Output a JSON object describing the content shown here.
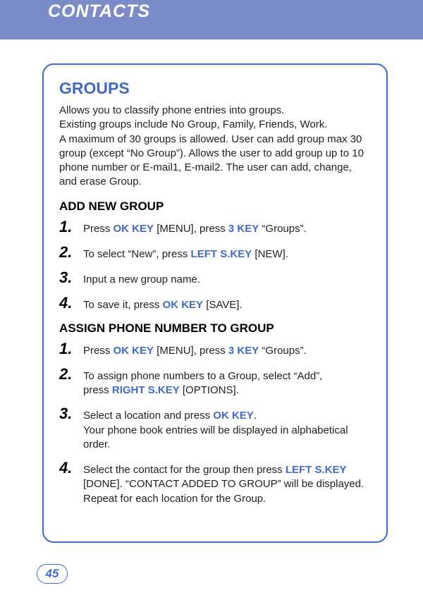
{
  "header": {
    "title": "CONTACTS"
  },
  "section": {
    "title": "GROUPS",
    "intro": "Allows you to classify phone entries into groups.\nExisting groups include No Group, Family, Friends, Work.\nA maximum of 30 groups is allowed. User can add group max 30 group (except “No Group”). Allows the user to add group up to 10 phone number or E-mail1, E-mail2. The user can add, change, and erase Group."
  },
  "sub1": {
    "heading": "ADD NEW GROUP",
    "steps": [
      {
        "num": "1.",
        "parts": [
          {
            "t": "Press ",
            "b": false
          },
          {
            "t": "OK KEY",
            "b": true
          },
          {
            "t": " [MENU], press ",
            "b": false
          },
          {
            "t": "3 KEY",
            "b": true
          },
          {
            "t": " “Groups”.",
            "b": false
          }
        ]
      },
      {
        "num": "2.",
        "parts": [
          {
            "t": "To select “New”, press ",
            "b": false
          },
          {
            "t": "LEFT S.KEY",
            "b": true
          },
          {
            "t": " [NEW].",
            "b": false
          }
        ]
      },
      {
        "num": "3.",
        "parts": [
          {
            "t": "Input a new group name.",
            "b": false
          }
        ]
      },
      {
        "num": "4.",
        "parts": [
          {
            "t": "To save it, press ",
            "b": false
          },
          {
            "t": "OK KEY",
            "b": true
          },
          {
            "t": " [SAVE].",
            "b": false
          }
        ]
      }
    ]
  },
  "sub2": {
    "heading": "ASSIGN PHONE NUMBER TO GROUP",
    "steps": [
      {
        "num": "1.",
        "parts": [
          {
            "t": "Press ",
            "b": false
          },
          {
            "t": "OK KEY",
            "b": true
          },
          {
            "t": " [MENU], press ",
            "b": false
          },
          {
            "t": "3 KEY",
            "b": true
          },
          {
            "t": " “Groups”.",
            "b": false
          }
        ]
      },
      {
        "num": "2.",
        "parts": [
          {
            "t": "To assign phone numbers to a Group, select “Add”,",
            "b": false
          },
          {
            "t": "\n",
            "b": false
          },
          {
            "t": "press ",
            "b": false
          },
          {
            "t": "RIGHT S.KEY",
            "b": true
          },
          {
            "t": " [OPTIONS].",
            "b": false
          }
        ]
      },
      {
        "num": "3.",
        "parts": [
          {
            "t": "Select a location and press ",
            "b": false
          },
          {
            "t": "OK KEY",
            "b": true
          },
          {
            "t": ".",
            "b": false
          },
          {
            "t": "\n",
            "b": false
          },
          {
            "t": "Your phone book entries will be displayed in alphabetical order.",
            "b": false
          }
        ]
      },
      {
        "num": "4.",
        "parts": [
          {
            "t": "Select the contact for the group then press ",
            "b": false
          },
          {
            "t": "LEFT S.KEY",
            "b": true
          },
          {
            "t": " [DONE]. “CONTACT ADDED TO GROUP” will be displayed. Repeat for each location for the Group.",
            "b": false
          }
        ]
      }
    ]
  },
  "page": {
    "number": "45"
  }
}
